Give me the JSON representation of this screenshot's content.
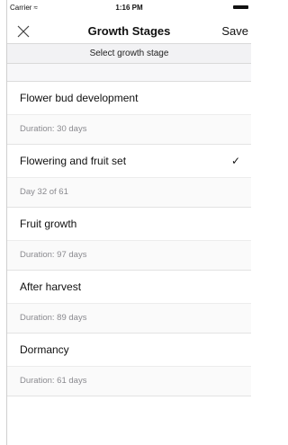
{
  "status": {
    "carrier": "Carrier",
    "time": "1:16 PM"
  },
  "nav": {
    "title": "Growth Stages",
    "save_label": "Save"
  },
  "subheader": "Select growth stage",
  "stages": [
    {
      "name": "Flower bud development",
      "detail": "Duration: 30 days",
      "selected": false
    },
    {
      "name": "Flowering and fruit set",
      "detail": "Day 32 of 61",
      "selected": true
    },
    {
      "name": "Fruit growth",
      "detail": "Duration: 97 days",
      "selected": false
    },
    {
      "name": "After harvest",
      "detail": "Duration: 89 days",
      "selected": false
    },
    {
      "name": "Dormancy",
      "detail": "Duration: 61 days",
      "selected": false
    }
  ]
}
